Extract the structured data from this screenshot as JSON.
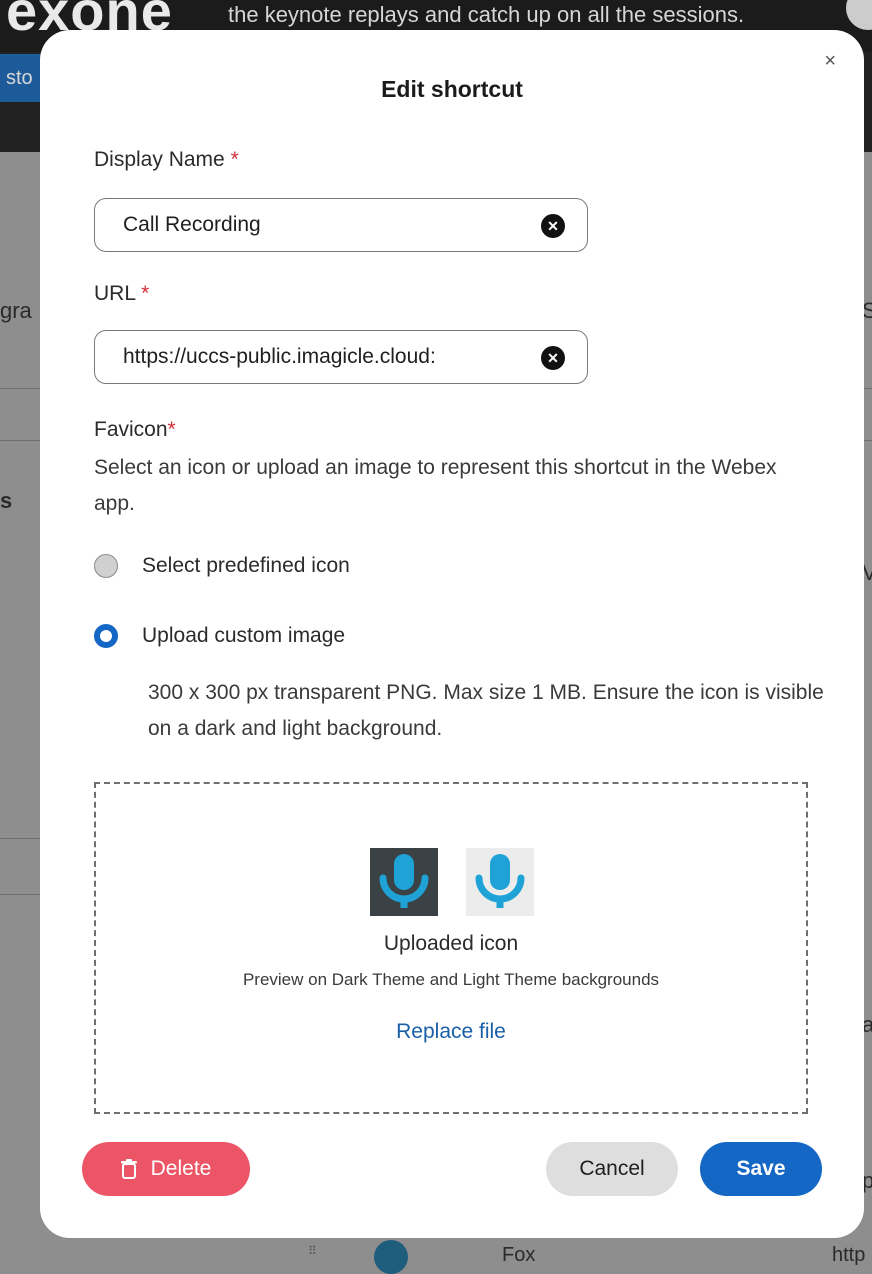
{
  "background": {
    "logo_fragment": "exone",
    "banner_fragment": "the keynote replays and catch up on all the sessions.",
    "nav_fragment": "sto",
    "left_fragment_1": "gra",
    "left_fragment_2": "s",
    "right_fragment_1": "S",
    "right_fragment_2": "V",
    "right_fragment_3": "a",
    "right_fragment_4": "p",
    "bottom_name": "Fox",
    "bottom_url": "http"
  },
  "modal": {
    "title": "Edit shortcut",
    "close_label": "×",
    "display_name": {
      "label": "Display Name",
      "required_mark": "*",
      "value": "Call Recording"
    },
    "url": {
      "label": "URL",
      "required_mark": "*",
      "value": "https://uccs-public.imagicle.cloud:"
    },
    "favicon": {
      "label": "Favicon",
      "required_mark": "*",
      "help": "Select an icon or upload an image to represent this shortcut in the Webex app.",
      "options": [
        {
          "label": "Select predefined icon",
          "selected": false
        },
        {
          "label": "Upload custom image",
          "selected": true
        }
      ],
      "upload_help": "300 x 300 px transparent PNG. Max size 1 MB. Ensure the icon is visible on a dark and light background.",
      "uploaded_label": "Uploaded icon",
      "preview_note": "Preview on Dark Theme and Light Theme backgrounds",
      "replace_label": "Replace file",
      "icon": "microphone-icon"
    },
    "buttons": {
      "delete": "Delete",
      "cancel": "Cancel",
      "save": "Save"
    }
  },
  "colors": {
    "primary": "#1467c4",
    "danger": "#ec5566",
    "required": "#d12f3b",
    "mic_blue": "#1fa3d6"
  }
}
